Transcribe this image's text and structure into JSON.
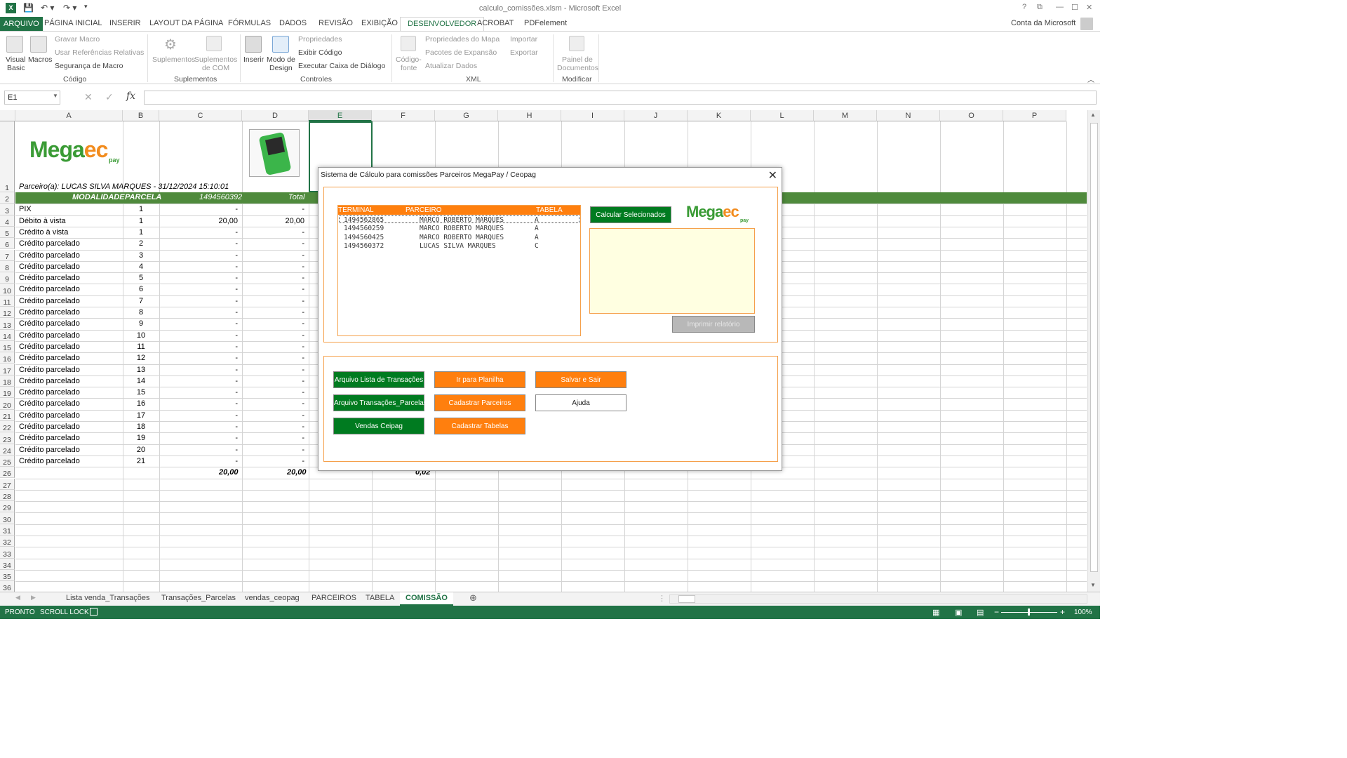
{
  "window": {
    "title": "calculo_comissões.xlsm - Microsoft Excel",
    "account": "Conta da Microsoft"
  },
  "tabs": [
    "ARQUIVO",
    "PÁGINA INICIAL",
    "INSERIR",
    "LAYOUT DA PÁGINA",
    "FÓRMULAS",
    "DADOS",
    "REVISÃO",
    "EXIBIÇÃO",
    "DESENVOLVEDOR",
    "ACROBAT",
    "PDFelement"
  ],
  "ribbon": {
    "visual_basic_1": "Visual",
    "visual_basic_2": "Basic",
    "macros": "Macros",
    "gravar": "Gravar Macro",
    "usar_ref": "Usar Referências Relativas",
    "seguranca": "Segurança de Macro",
    "grp_codigo": "Código",
    "suplementos": "Suplementos",
    "suplementos_com_1": "Suplementos",
    "suplementos_com_2": "de COM",
    "grp_suplementos": "Suplementos",
    "inserir": "Inserir",
    "modo_design_1": "Modo de",
    "modo_design_2": "Design",
    "propriedades": "Propriedades",
    "exibir_codigo": "Exibir Código",
    "executar_caixa": "Executar Caixa de Diálogo",
    "grp_controles": "Controles",
    "codigo_fonte_1": "Código-",
    "codigo_fonte_2": "fonte",
    "prop_mapa": "Propriedades do Mapa",
    "pacotes": "Pacotes de Expansão",
    "atualizar": "Atualizar Dados",
    "importar": "Importar",
    "exportar": "Exportar",
    "grp_xml": "XML",
    "painel_1": "Painel de",
    "painel_2": "Documentos",
    "grp_modificar": "Modificar"
  },
  "namebox": "E1",
  "formula": "",
  "columns": [
    "A",
    "B",
    "C",
    "D",
    "E",
    "F",
    "G",
    "H",
    "I",
    "J",
    "K",
    "L",
    "M",
    "N",
    "O",
    "P"
  ],
  "sheet": {
    "logo": {
      "mega": "Mega",
      "ec": "ec",
      "pay": "pay"
    },
    "row1": "Parceiro(a): LUCAS SILVA MARQUES   -   31/12/2024 15:10:01",
    "headers": {
      "modalidade": "MODALIDADE",
      "parcela": "PARCELA",
      "terminal": "1494560392",
      "total": "Total"
    },
    "rows": [
      {
        "m": "PIX",
        "p": "1",
        "c": "-",
        "d": "-"
      },
      {
        "m": "Débito à vista",
        "p": "1",
        "c": "20,00",
        "d": "20,00"
      },
      {
        "m": "Crédito à vista",
        "p": "1",
        "c": "-",
        "d": "-"
      },
      {
        "m": "Crédito parcelado",
        "p": "2",
        "c": "-",
        "d": "-"
      },
      {
        "m": "Crédito parcelado",
        "p": "3",
        "c": "-",
        "d": "-"
      },
      {
        "m": "Crédito parcelado",
        "p": "4",
        "c": "-",
        "d": "-"
      },
      {
        "m": "Crédito parcelado",
        "p": "5",
        "c": "-",
        "d": "-"
      },
      {
        "m": "Crédito parcelado",
        "p": "6",
        "c": "-",
        "d": "-"
      },
      {
        "m": "Crédito parcelado",
        "p": "7",
        "c": "-",
        "d": "-"
      },
      {
        "m": "Crédito parcelado",
        "p": "8",
        "c": "-",
        "d": "-"
      },
      {
        "m": "Crédito parcelado",
        "p": "9",
        "c": "-",
        "d": "-"
      },
      {
        "m": "Crédito parcelado",
        "p": "10",
        "c": "-",
        "d": "-"
      },
      {
        "m": "Crédito parcelado",
        "p": "11",
        "c": "-",
        "d": "-"
      },
      {
        "m": "Crédito parcelado",
        "p": "12",
        "c": "-",
        "d": "-"
      },
      {
        "m": "Crédito parcelado",
        "p": "13",
        "c": "-",
        "d": "-"
      },
      {
        "m": "Crédito parcelado",
        "p": "14",
        "c": "-",
        "d": "-"
      },
      {
        "m": "Crédito parcelado",
        "p": "15",
        "c": "-",
        "d": "-"
      },
      {
        "m": "Crédito parcelado",
        "p": "16",
        "c": "-",
        "d": "-"
      },
      {
        "m": "Crédito parcelado",
        "p": "17",
        "c": "-",
        "d": "-"
      },
      {
        "m": "Crédito parcelado",
        "p": "18",
        "c": "-",
        "d": "-"
      },
      {
        "m": "Crédito parcelado",
        "p": "19",
        "c": "-",
        "d": "-"
      },
      {
        "m": "Crédito parcelado",
        "p": "20",
        "c": "-",
        "d": "-"
      },
      {
        "m": "Crédito parcelado",
        "p": "21",
        "c": "-",
        "d": "-"
      }
    ],
    "totals": {
      "c": "20,00",
      "d": "20,00",
      "f": "0,02"
    }
  },
  "dialog": {
    "title": "Sistema de Cálculo para comissões Parceiros MegaPay / Ceopag",
    "list_headers": [
      "TERMINAL",
      "PARCEIRO",
      "TABELA"
    ],
    "list_rows": [
      {
        "terminal": "1494562865",
        "parceiro": "MARCO ROBERTO MARQUES",
        "tabela": "A"
      },
      {
        "terminal": "1494560259",
        "parceiro": "MARCO ROBERTO MARQUES",
        "tabela": "A"
      },
      {
        "terminal": "1494560425",
        "parceiro": "MARCO ROBERTO MARQUES",
        "tabela": "A"
      },
      {
        "terminal": "1494560372",
        "parceiro": "LUCAS SILVA MARQUES",
        "tabela": "C"
      }
    ],
    "calc_btn": "Calcular Selecionados",
    "print_btn": "Imprimir relatório",
    "btn_lista": "Arquivo Lista de Transações",
    "btn_parcelas": "Arquivo Transações_Parcelas",
    "btn_vendas": "Vendas Ceipag",
    "btn_ir": "Ir para Planilha",
    "btn_cad_parc": "Cadastrar Parceiros",
    "btn_cad_tab": "Cadastrar Tabelas",
    "btn_salvar": "Salvar e Sair",
    "btn_ajuda": "Ajuda"
  },
  "sheet_tabs": [
    "Lista venda_Transações",
    "Transações_Parcelas",
    "vendas_ceopag",
    "PARCEIROS",
    "TABELA",
    "COMISSÃO"
  ],
  "status": {
    "pronto": "PRONTO",
    "scroll": "SCROLL LOCK",
    "zoom": "100%"
  },
  "colors": {
    "excel_green": "#217346",
    "header_green": "#4f8a3c",
    "orange": "#ff7f0e",
    "btn_green": "#007b20"
  }
}
